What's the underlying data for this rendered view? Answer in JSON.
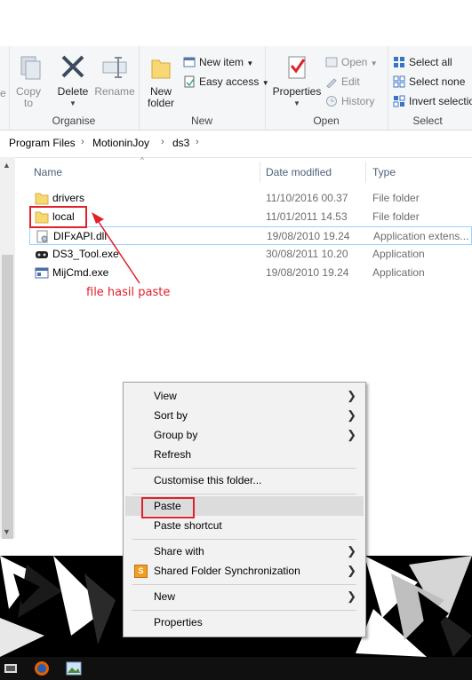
{
  "ribbon": {
    "organise": {
      "label": "Organise",
      "copy_to": "Copy\nto",
      "delete": "Delete",
      "rename": "Rename"
    },
    "new": {
      "label": "New",
      "new_folder": "New\nfolder",
      "new_item": "New item",
      "easy_access": "Easy access"
    },
    "open": {
      "label": "Open",
      "properties": "Properties",
      "open": "Open",
      "edit": "Edit",
      "history": "History"
    },
    "select": {
      "label": "Select",
      "select_all": "Select all",
      "select_none": "Select none",
      "invert_selection": "Invert selection"
    }
  },
  "breadcrumb": [
    "Program Files",
    "MotioninJoy",
    "ds3"
  ],
  "columns": {
    "name": "Name",
    "date": "Date modified",
    "type": "Type"
  },
  "files": [
    {
      "name": "drivers",
      "date": "11/10/2016 00.37",
      "type": "File folder",
      "icon": "folder-icon"
    },
    {
      "name": "local",
      "date": "11/01/2011 14.53",
      "type": "File folder",
      "icon": "folder-icon"
    },
    {
      "name": "DIFxAPI.dll",
      "date": "19/08/2010 19.24",
      "type": "Application extens...",
      "icon": "dll-icon"
    },
    {
      "name": "DS3_Tool.exe",
      "date": "30/08/2011 10.20",
      "type": "Application",
      "icon": "gamepad-icon"
    },
    {
      "name": "MijCmd.exe",
      "date": "19/08/2010 19.24",
      "type": "Application",
      "icon": "exe-icon"
    }
  ],
  "annotation": {
    "text": "file hasil paste",
    "color": "#e0202a"
  },
  "context_menu": {
    "view": "View",
    "sort_by": "Sort by",
    "group_by": "Group by",
    "refresh": "Refresh",
    "customise": "Customise this folder...",
    "paste": "Paste",
    "paste_shortcut": "Paste shortcut",
    "share_with": "Share with",
    "shared_folder_sync": "Shared Folder Synchronization",
    "new": "New",
    "properties": "Properties"
  },
  "ribbon_left_partial": {
    "label_fragment": "e"
  }
}
